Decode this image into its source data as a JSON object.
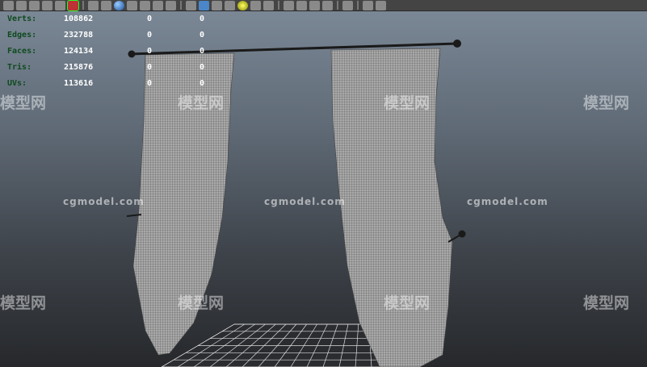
{
  "toolbar": {
    "icons": [
      "render-icon",
      "render-view-icon",
      "hypershade-icon",
      "paint-icon",
      "script-icon",
      "selection-icon",
      "wireframe-icon",
      "grid-icon",
      "sphere-shaded-icon",
      "flat-shaded-icon",
      "xray-icon",
      "components-icon",
      "texture-icon",
      "camera-icon",
      "cube-icon",
      "cube-shaded-icon",
      "checker-icon",
      "light-icon",
      "material-icon",
      "shadow-icon",
      "isolate-icon",
      "ambient-occlusion-icon",
      "motion-blur-icon",
      "antialias-icon",
      "select-camera-icon",
      "frame-icon",
      "bookmark-icon"
    ]
  },
  "stats": [
    {
      "label": "Verts:",
      "total": "108862",
      "selected": "0",
      "other": "0"
    },
    {
      "label": "Edges:",
      "total": "232788",
      "selected": "0",
      "other": "0"
    },
    {
      "label": "Faces:",
      "total": "124134",
      "selected": "0",
      "other": "0"
    },
    {
      "label": "Tris:",
      "total": "215876",
      "selected": "0",
      "other": "0"
    },
    {
      "label": "UVs:",
      "total": "113616",
      "selected": "0",
      "other": "0"
    }
  ],
  "watermark": {
    "url": "cgmodel.com",
    "brand": "模型网"
  },
  "colors": {
    "stats_label": "#0e4a1e",
    "curtain": "#9a9a9a",
    "rod": "#1a1a1a"
  }
}
